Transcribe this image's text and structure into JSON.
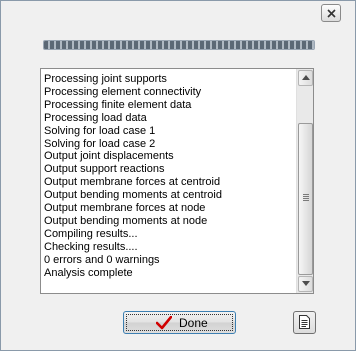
{
  "window": {
    "title": "",
    "close_icon": "close-icon"
  },
  "progress": {
    "value_percent": 100
  },
  "log": {
    "lines": [
      "Processing joint supports",
      "Processing element connectivity",
      "Processing finite element data",
      "Processing load data",
      "Solving for load case 1",
      "Solving for load case 2",
      "Output joint displacements",
      "Output support reactions",
      "Output membrane forces at centroid",
      "Output bending moments at centroid",
      "Output membrane forces at node",
      "Output bending moments at node",
      "Compiling results...",
      "Checking results....",
      "0 errors and 0 warnings",
      "Analysis complete"
    ]
  },
  "buttons": {
    "done_label": "Done",
    "done_icon": "checkmark-icon",
    "report_icon": "document-icon"
  },
  "colors": {
    "checkmark": "#d10000",
    "progress": "#5b6875"
  }
}
